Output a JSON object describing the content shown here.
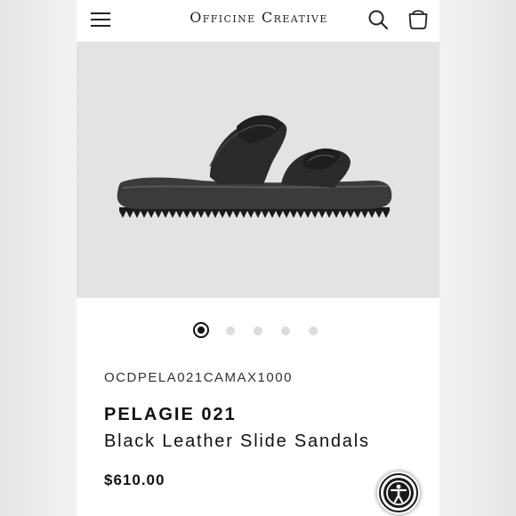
{
  "header": {
    "brand": "Officine Creative",
    "menu_icon": "hamburger-menu-icon",
    "search_icon": "search-icon",
    "cart_icon": "shopping-bag-icon"
  },
  "gallery": {
    "image_alt": "Black leather slide sandal with knotted straps",
    "slides": 5,
    "active_slide": 1
  },
  "product": {
    "sku": "OCDPELA021CAMAX1000",
    "name": "PELAGIE 021",
    "description": "Black Leather Slide Sandals",
    "price": "$610.00"
  },
  "colors": {
    "background": "#ffffff",
    "image_bg": "#e3e3e3",
    "text": "#111111",
    "accent": "#1a1a1a"
  },
  "accessibility": {
    "icon": "accessibility-person-icon"
  }
}
